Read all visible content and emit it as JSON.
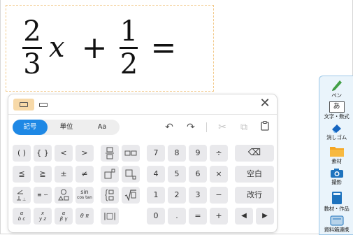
{
  "formula": {
    "frac1_num": "2",
    "frac1_den": "3",
    "variable": "x",
    "plus": "+",
    "frac2_num": "1",
    "frac2_den": "2",
    "equals": "="
  },
  "toolbar": {
    "items": [
      {
        "label": "ペン",
        "icon": "pen-icon"
      },
      {
        "label": "文字・数式",
        "glyph": "あ",
        "icon": "text-icon"
      },
      {
        "label": "消しゴム",
        "icon": "eraser-icon"
      },
      {
        "label": "素材",
        "icon": "folder-icon"
      },
      {
        "label": "撮影",
        "icon": "camera-icon"
      },
      {
        "label": "教材・作品",
        "icon": "book-icon"
      },
      {
        "label": "資料箱連携",
        "icon": "tray-icon"
      }
    ]
  },
  "panel": {
    "close": "✕",
    "tabs": [
      "記号",
      "単位",
      "Aa"
    ],
    "undo": "↶",
    "redo": "↷",
    "cut": "✂",
    "copy": "⧉",
    "paste": "📋",
    "keys": {
      "r1": [
        "( )",
        "{ }",
        "<",
        ">",
        "",
        "",
        "7",
        "8",
        "9",
        "÷",
        "⌫"
      ],
      "r2": [
        "≦",
        "≧",
        "±",
        "≠",
        "",
        "",
        "4",
        "5",
        "6",
        "×",
        "空白"
      ],
      "r3": [
        "",
        "≡ ∽",
        "",
        "sin",
        "cos tan",
        "",
        "√",
        "1",
        "2",
        "3",
        "−",
        "改行"
      ],
      "r4": [
        "α",
        "b c",
        "x",
        "y z",
        "α",
        "β γ",
        "θ π",
        "|□|",
        "0",
        ".",
        "=",
        "+",
        "◀",
        "▶"
      ]
    }
  },
  "colors": {
    "accent": "#1e88e5",
    "active_tab_bg": "#f7d9a8",
    "dashed_border": "#f2c98a",
    "toolbar_bg": "#eaf4fb"
  }
}
